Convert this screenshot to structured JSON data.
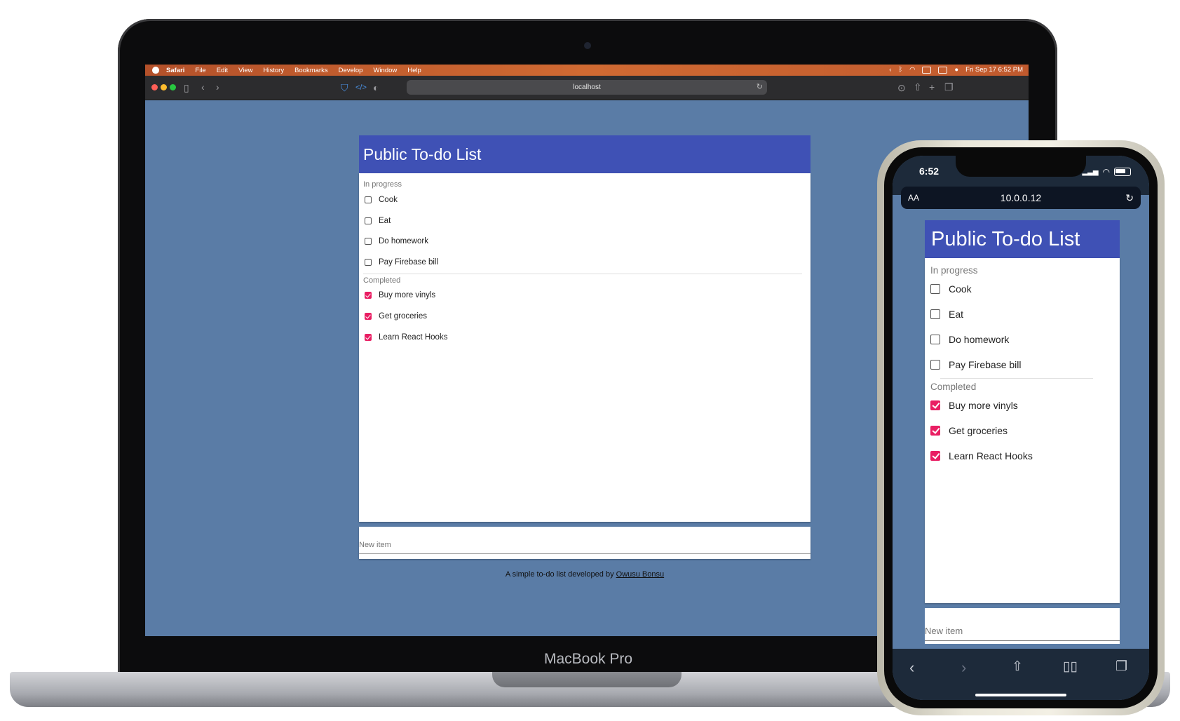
{
  "mac": {
    "brand_label": "MacBook Pro",
    "menubar": {
      "items": [
        "Safari",
        "File",
        "Edit",
        "View",
        "History",
        "Bookmarks",
        "Develop",
        "Window",
        "Help"
      ],
      "clock": "Fri Sep 17  6:52 PM"
    },
    "safari": {
      "address": "localhost"
    }
  },
  "app": {
    "title": "Public To-do List",
    "in_progress_label": "In progress",
    "completed_label": "Completed",
    "in_progress": [
      "Cook",
      "Eat",
      "Do homework",
      "Pay Firebase bill"
    ],
    "completed": [
      "Buy more vinyls",
      "Get groceries",
      "Learn React Hooks"
    ],
    "new_item_placeholder": "New item",
    "footer_prefix": "A simple to-do list developed by ",
    "footer_link": "Owusu Bonsu",
    "colors": {
      "header": "#3f51b5",
      "background": "#5a7ca6",
      "checked": "#e91e63"
    }
  },
  "phone": {
    "time": "6:52",
    "address": "10.0.0.12",
    "text_size_button": "AA"
  }
}
